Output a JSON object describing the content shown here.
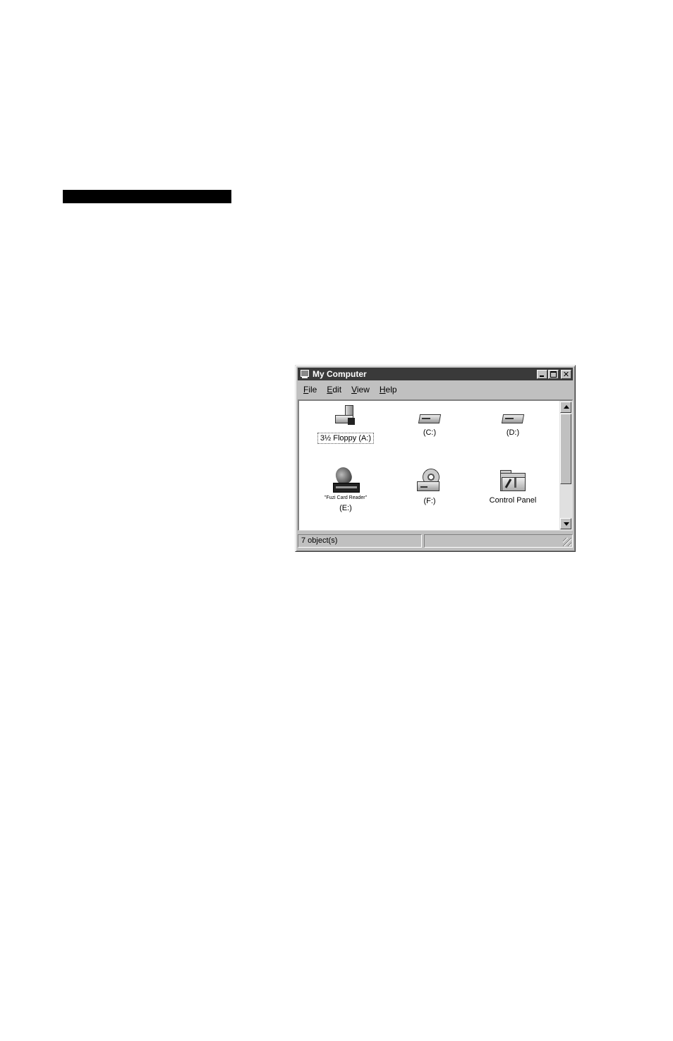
{
  "window": {
    "title": "My Computer",
    "title_icon": "computer-icon",
    "controls": [
      "minimize",
      "maximize",
      "close"
    ]
  },
  "menu": [
    {
      "label": "File"
    },
    {
      "label": "Edit"
    },
    {
      "label": "View"
    },
    {
      "label": "Help"
    }
  ],
  "items": [
    {
      "label": "3½ Floppy (A:)",
      "icon": "floppy-drive-icon",
      "selected": true
    },
    {
      "label": "(C:)",
      "icon": "hard-drive-icon"
    },
    {
      "label": "(D:)",
      "icon": "hard-drive-icon"
    },
    {
      "label_top": "\"Fuzi Card Reader\"",
      "label": "(E:)",
      "icon": "card-reader-icon"
    },
    {
      "label": "(F:)",
      "icon": "cd-drive-icon"
    },
    {
      "label": "Control Panel",
      "icon": "control-panel-folder-icon"
    }
  ],
  "status": {
    "objects": "7 object(s)"
  },
  "colors": {
    "titlebar": "#3a3a3a",
    "window_bg": "#c0c0c0",
    "content_bg": "#ffffff"
  }
}
